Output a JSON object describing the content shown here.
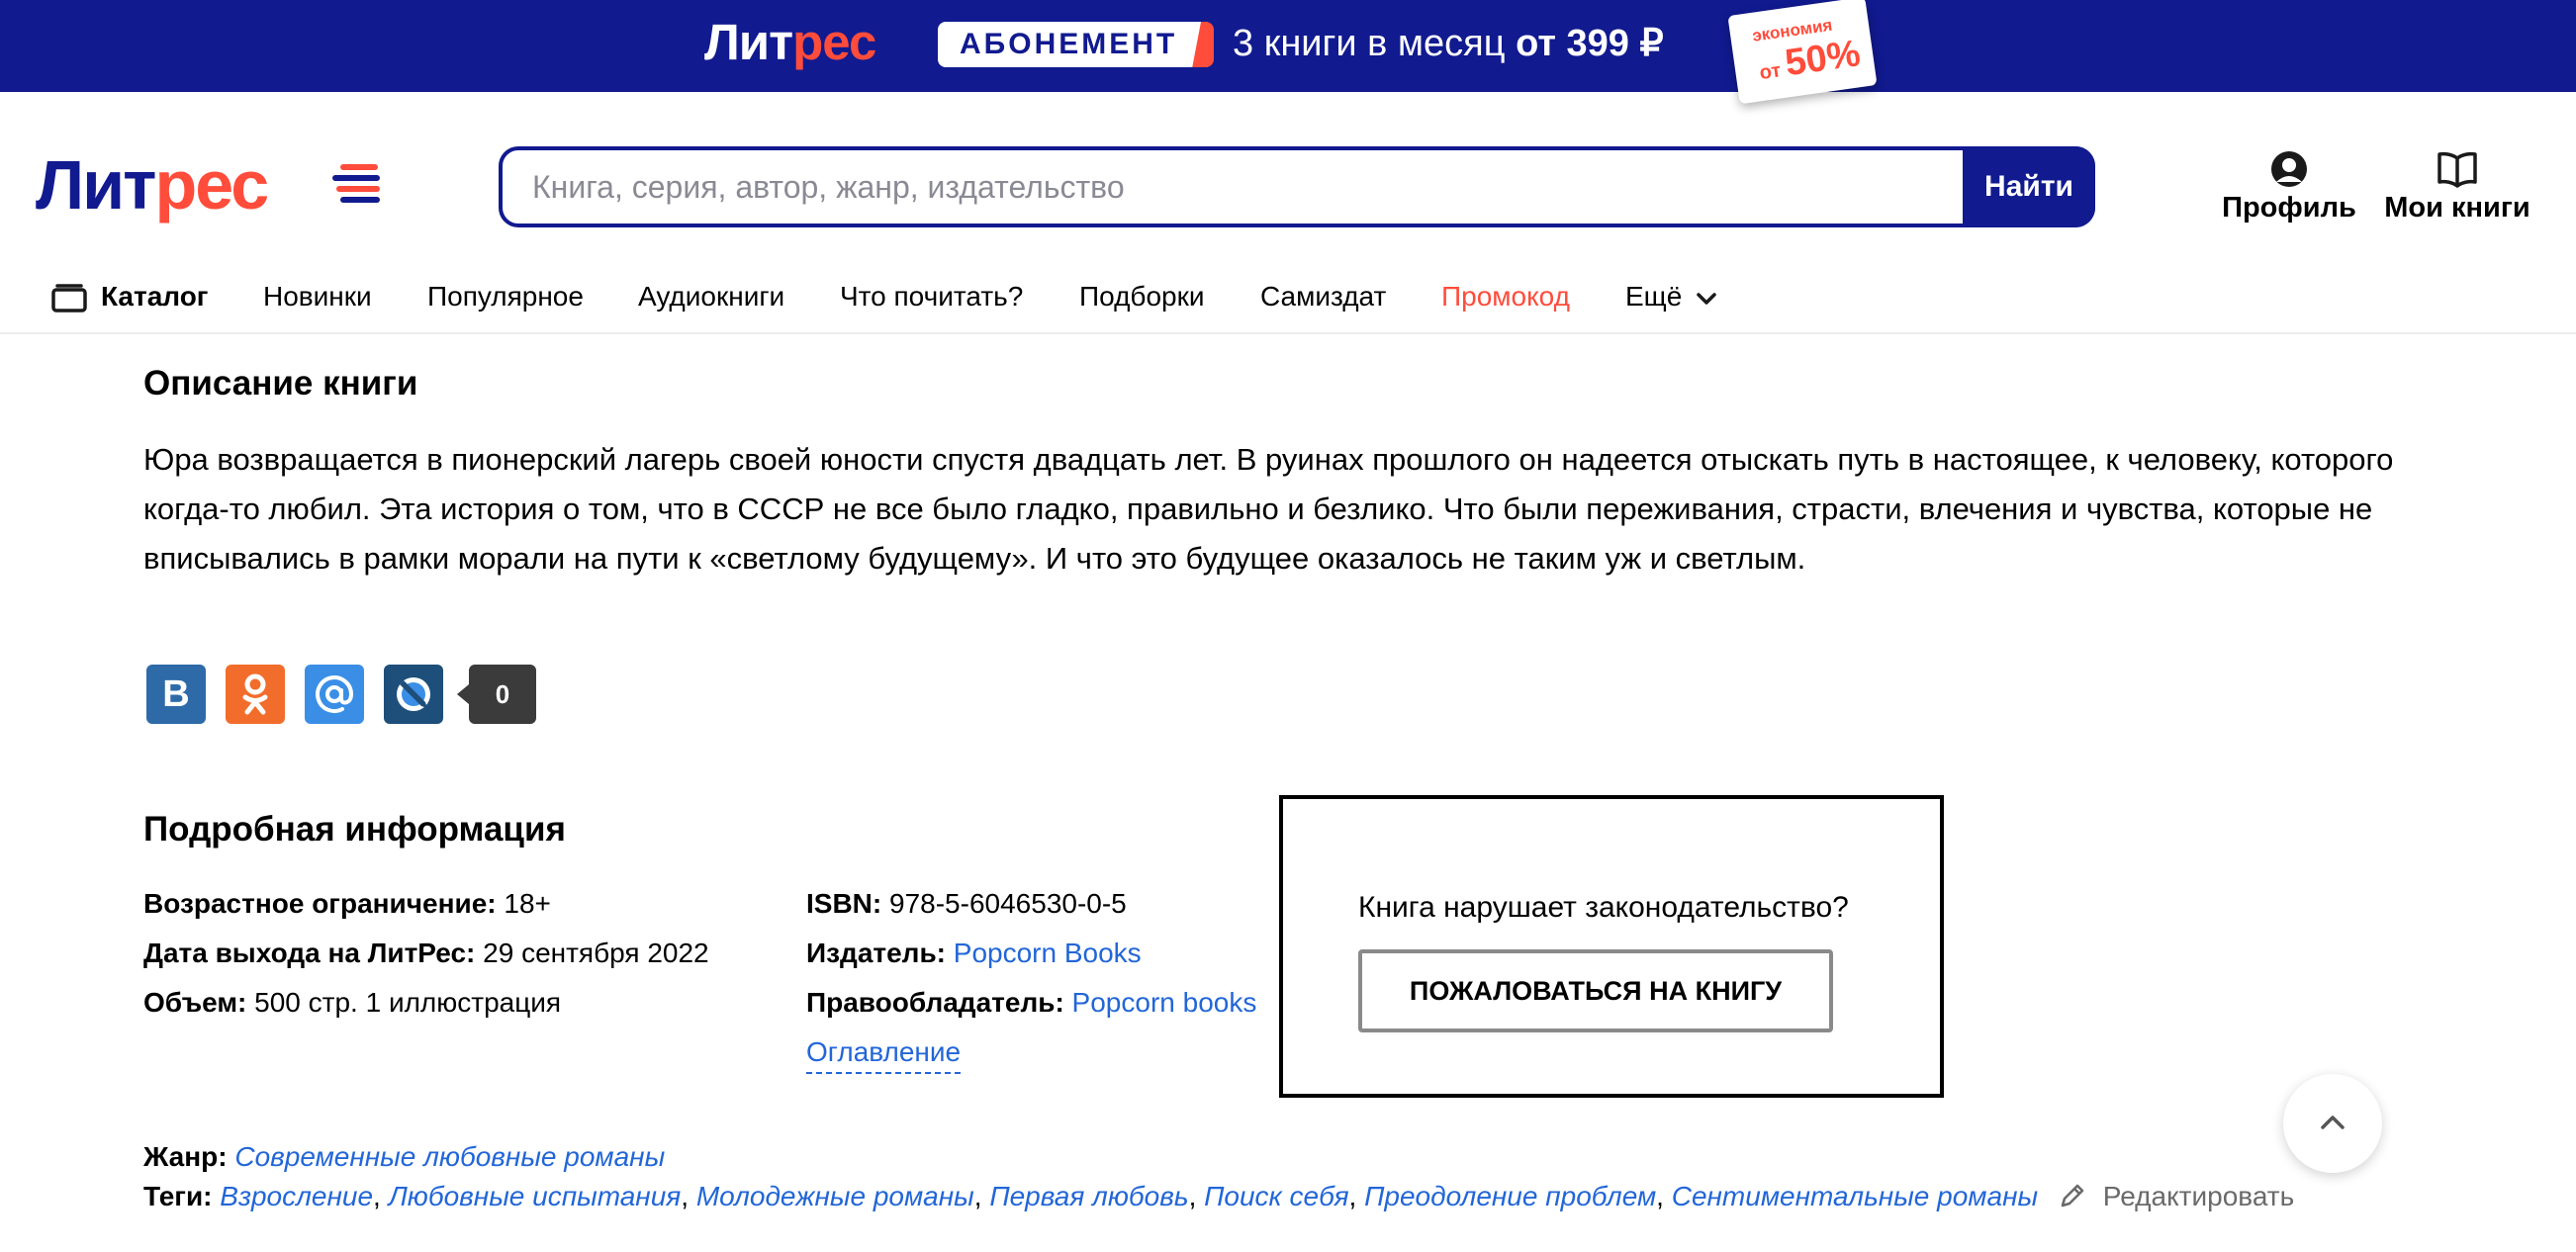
{
  "promo": {
    "logo_main": "Лит",
    "logo_accent": "рес",
    "chip": "АБОНЕМЕНТ",
    "text_prefix": "3 книги в месяц ",
    "text_price": "от 399 ₽",
    "badge_small": "экономия",
    "badge_from": "от ",
    "badge_percent": "50%"
  },
  "header": {
    "logo_main": "Лит",
    "logo_accent": "рес",
    "search_placeholder": "Книга, серия, автор, жанр, издательство",
    "search_button": "Найти",
    "profile": "Профиль",
    "my_books": "Мои книги"
  },
  "nav": {
    "catalog": "Каталог",
    "items": [
      "Новинки",
      "Популярное",
      "Аудиокниги",
      "Что почитать?",
      "Подборки",
      "Самиздат",
      "Промокод",
      "Ещё"
    ]
  },
  "description": {
    "title": "Описание книги",
    "lines": [
      "Юра возвращается в пионерский лагерь своей юности спустя двадцать лет. В руинах прошлого он надеется отыскать путь в настоящее, к человеку, которого",
      "когда-то любил. Эта история о том, что в СССР не все было гладко, правильно и безлико. Что были переживания, страсти, влечения и чувства, которые не",
      "вписывались в рамки морали на пути к «светлому будущему». И что это будущее оказалось не таким уж и светлым."
    ]
  },
  "share": {
    "vk": "В",
    "count": "0"
  },
  "details": {
    "title": "Подробная информация",
    "age_label": "Возрастное ограничение:",
    "age_value": "18+",
    "date_label": "Дата выхода на ЛитРес:",
    "date_value": "29 сентября 2022",
    "volume_label": "Объем:",
    "volume_value": "500 стр. 1 иллюстрация",
    "isbn_label": "ISBN:",
    "isbn_value": "978-5-6046530-0-5",
    "publisher_label": "Издатель:",
    "publisher_value": "Popcorn Books",
    "rightsholder_label": "Правообладатель:",
    "rightsholder_value": "Popcorn books",
    "toc": "Оглавление"
  },
  "complaint": {
    "question": "Книга нарушает законодательство?",
    "button": "ПОЖАЛОВАТЬСЯ НА КНИГУ"
  },
  "genre": {
    "label": "Жанр:",
    "value": "Современные любовные романы"
  },
  "tags": {
    "label": "Теги:",
    "items": [
      "Взросление",
      "Любовные испытания",
      "Молодежные романы",
      "Первая любовь",
      "Поиск себя",
      "Преодоление проблем",
      "Сентиментальные романы"
    ],
    "separator": ", ",
    "edit": "Редактировать"
  },
  "colors": {
    "brand_blue": "#111a8f",
    "brand_red": "#ff4c3b",
    "link_blue": "#2266d8",
    "vk": "#2e6aa8",
    "ok": "#f26d2b",
    "mail": "#3a8ee6",
    "lj": "#1d4f7a"
  }
}
